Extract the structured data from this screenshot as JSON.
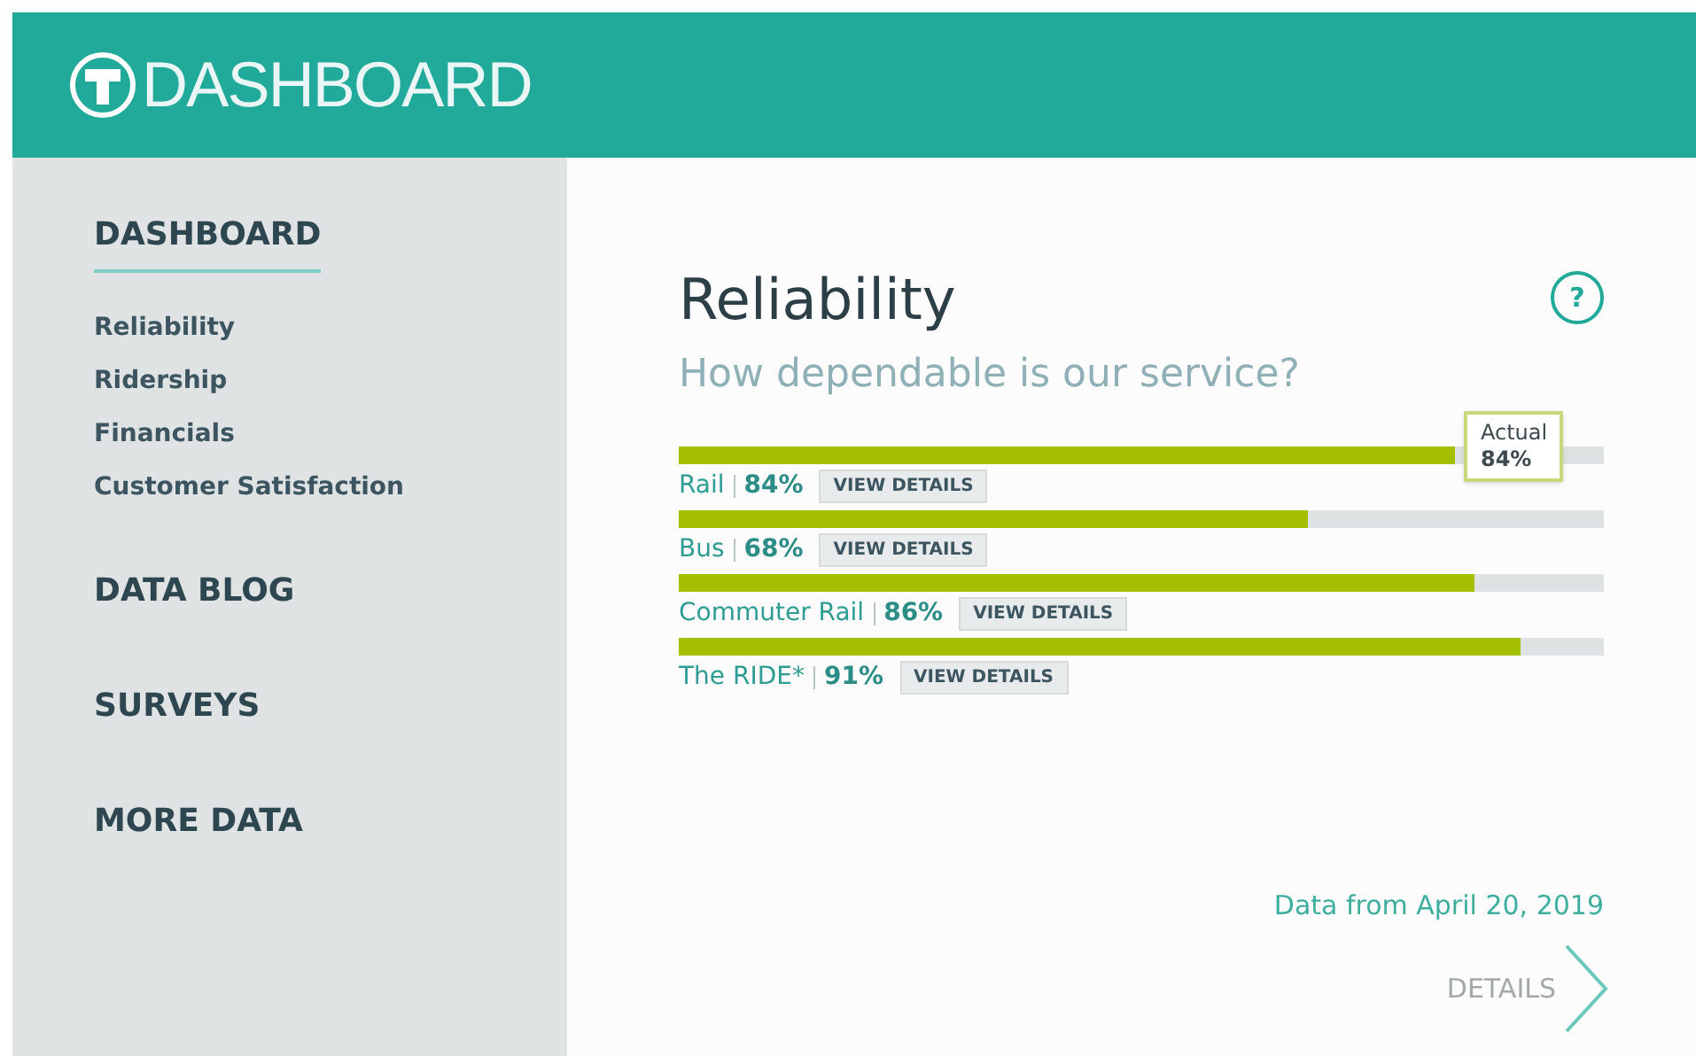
{
  "header": {
    "title": "DASHBOARD"
  },
  "sidebar": {
    "sections": [
      {
        "label": "DASHBOARD",
        "selected": true,
        "items": [
          "Reliability",
          "Ridership",
          "Financials",
          "Customer Satisfaction"
        ]
      },
      {
        "label": "DATA BLOG",
        "selected": false
      },
      {
        "label": "SURVEYS",
        "selected": false
      },
      {
        "label": "MORE DATA",
        "selected": false
      }
    ]
  },
  "panel": {
    "title": "Reliability",
    "subtitle": "How dependable is our service?",
    "help": "?",
    "rows": [
      {
        "name": "Rail",
        "percent": "84%",
        "level": 0.84,
        "button": "VIEW DETAILS",
        "tooltip": {
          "label": "Actual",
          "value": "84%"
        }
      },
      {
        "name": "Bus",
        "percent": "68%",
        "level": 0.68,
        "button": "VIEW DETAILS"
      },
      {
        "name": "Commuter Rail",
        "percent": "86%",
        "level": 0.86,
        "button": "VIEW DETAILS"
      },
      {
        "name": "The RIDE*",
        "percent": "91%",
        "level": 0.91,
        "button": "VIEW DETAILS"
      }
    ],
    "date": "Data from April 20, 2019",
    "details_link": "DETAILS"
  }
}
